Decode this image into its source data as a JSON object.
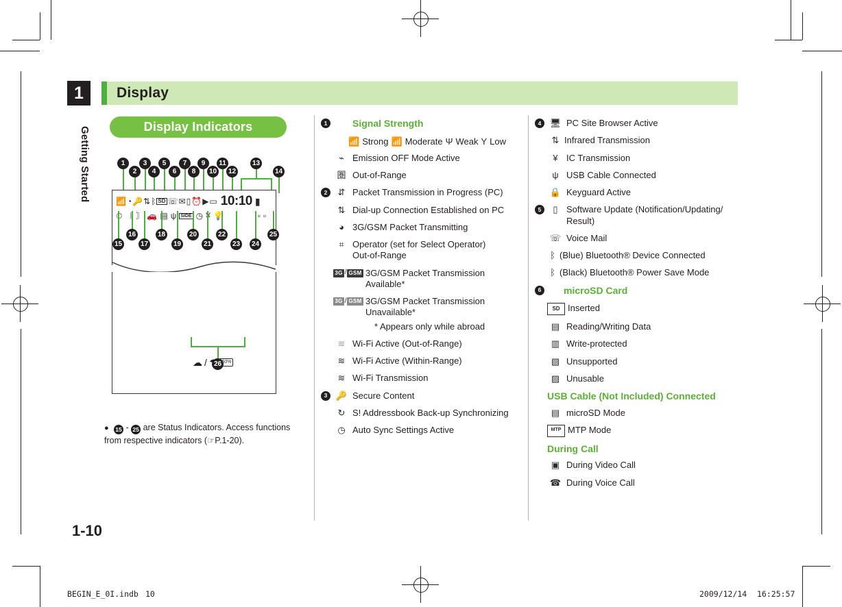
{
  "page": {
    "chapter_number": "1",
    "chapter_label": "Getting Started",
    "section_title": "Display",
    "page_number": "1-10"
  },
  "figure": {
    "pill_title": "Display Indicators",
    "clock": "10:10",
    "humidity_badge": "50%",
    "callouts": [
      "1",
      "2",
      "3",
      "4",
      "5",
      "6",
      "7",
      "8",
      "9",
      "10",
      "11",
      "12",
      "13",
      "14",
      "15",
      "16",
      "17",
      "18",
      "19",
      "20",
      "21",
      "22",
      "23",
      "24",
      "25",
      "26"
    ],
    "note": {
      "bullet": "●",
      "from": "15",
      "to": "25",
      "text_before": " - ",
      "text_after": " are Status Indicators. Access functions from respective indicators (",
      "ref": "P.1-20",
      "text_end": ")."
    }
  },
  "legend_left": [
    {
      "num": "1",
      "icon": "",
      "label": "Signal Strength",
      "green": true
    },
    {
      "num": "",
      "icon": "signal-icons",
      "label": "",
      "inline": [
        {
          "icon": "signal-strong",
          "text": "Strong"
        },
        {
          "icon": "signal-moderate",
          "text": "Moderate"
        },
        {
          "icon": "signal-weak",
          "text": "Weak"
        },
        {
          "icon": "signal-low",
          "text": "Low"
        }
      ]
    },
    {
      "num": "",
      "icon": "emission-off",
      "label": "Emission OFF Mode Active"
    },
    {
      "num": "",
      "icon": "out-of-range",
      "label": "Out-of-Range"
    },
    {
      "num": "2",
      "icon": "packet-pc",
      "label": "Packet Transmission in Progress (PC)"
    },
    {
      "num": "",
      "icon": "dialup-pc",
      "label": "Dial-up Connection Established on PC"
    },
    {
      "num": "",
      "icon": "packet-transmitting",
      "label": "3G/GSM Packet Transmitting"
    },
    {
      "num": "",
      "icon": "operator-out-of-range",
      "label": "Operator (set for Select Operator)\nOut-of-Range"
    },
    {
      "num": "",
      "icon": "3g-gsm-available",
      "label": "3G/GSM Packet Transmission Available*"
    },
    {
      "num": "",
      "icon": "3g-gsm-unavailable",
      "label": "3G/GSM Packet Transmission Unavailable*",
      "sub": "* Appears only while abroad"
    },
    {
      "num": "",
      "icon": "wifi-out-of-range",
      "label": "Wi-Fi Active (Out-of-Range)"
    },
    {
      "num": "",
      "icon": "wifi-within-range",
      "label": "Wi-Fi Active (Within-Range)"
    },
    {
      "num": "",
      "icon": "wifi-transmission",
      "label": "Wi-Fi Transmission"
    },
    {
      "num": "3",
      "icon": "secure-content",
      "label": "Secure Content"
    },
    {
      "num": "",
      "icon": "addressbook-sync",
      "label": "S! Addressbook Back-up Synchronizing"
    },
    {
      "num": "",
      "icon": "auto-sync",
      "label": "Auto Sync Settings Active"
    }
  ],
  "legend_right": [
    {
      "num": "4",
      "icon": "pc-site-browser",
      "label": "PC Site Browser Active"
    },
    {
      "num": "",
      "icon": "infrared",
      "label": "Infrared Transmission"
    },
    {
      "num": "",
      "icon": "ic-transmission",
      "label": "IC Transmission"
    },
    {
      "num": "",
      "icon": "usb-cable",
      "label": "USB Cable Connected"
    },
    {
      "num": "",
      "icon": "keyguard",
      "label": "Keyguard Active"
    },
    {
      "num": "5",
      "icon": "software-update",
      "label": "Software Update (Notification/Updating/\nResult)"
    },
    {
      "num": "",
      "icon": "voice-mail",
      "label": "Voice Mail"
    },
    {
      "num": "",
      "icon": "bluetooth-blue",
      "label": "(Blue)   Bluetooth® Device Connected"
    },
    {
      "num": "",
      "icon": "bluetooth-black",
      "label": "(Black) Bluetooth® Power Save Mode"
    },
    {
      "num": "6",
      "icon": "",
      "label": "microSD Card",
      "green": true
    },
    {
      "num": "",
      "icon": "sd-inserted",
      "label": "Inserted"
    },
    {
      "num": "",
      "icon": "sd-reading-writing",
      "label": "Reading/Writing Data"
    },
    {
      "num": "",
      "icon": "sd-write-protected",
      "label": "Write-protected"
    },
    {
      "num": "",
      "icon": "sd-unsupported",
      "label": "Unsupported"
    },
    {
      "num": "",
      "icon": "sd-unusable",
      "label": "Unusable"
    },
    {
      "num": "",
      "icon": "",
      "label": "USB Cable (Not Included) Connected",
      "green": true,
      "nopad": true
    },
    {
      "num": "",
      "icon": "microsd-mode",
      "label": "microSD Mode"
    },
    {
      "num": "",
      "icon": "mtp-mode",
      "label": "MTP Mode"
    },
    {
      "num": "",
      "icon": "",
      "label": "During Call",
      "green": true,
      "nopad": true
    },
    {
      "num": "",
      "icon": "during-video-call",
      "label": "During Video Call"
    },
    {
      "num": "",
      "icon": "during-voice-call",
      "label": "During Voice Call"
    }
  ],
  "footer": {
    "file": "BEGIN_E_0I.indb",
    "folio": "10",
    "date": "2009/12/14",
    "time": "16:25:57"
  },
  "colors": {
    "green_accent": "#5cb036",
    "green_pill": "#76c043",
    "green_band": "#cfe9b6",
    "dark": "#231f20"
  }
}
